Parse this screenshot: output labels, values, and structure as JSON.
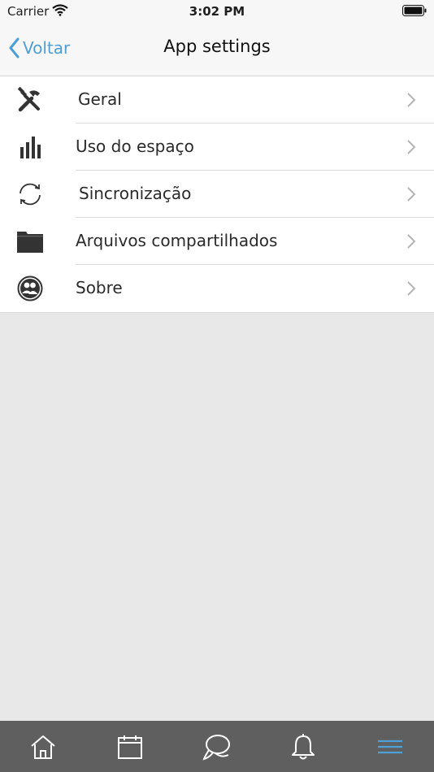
{
  "status_bar": {
    "carrier": "Carrier",
    "time": "3:02 PM"
  },
  "nav": {
    "back_label": "Voltar",
    "title": "App settings"
  },
  "settings": [
    {
      "label": "Geral",
      "icon": "tools-icon"
    },
    {
      "label": "Uso do espaço",
      "icon": "bar-chart-icon"
    },
    {
      "label": "Sincronização",
      "icon": "sync-icon"
    },
    {
      "label": "Arquivos compartilhados",
      "icon": "folder-icon"
    },
    {
      "label": "Sobre",
      "icon": "users-icon"
    }
  ],
  "tabs": [
    {
      "icon": "home-icon"
    },
    {
      "icon": "calendar-icon"
    },
    {
      "icon": "chat-icon"
    },
    {
      "icon": "bell-icon"
    },
    {
      "icon": "menu-icon",
      "active": true
    }
  ],
  "colors": {
    "accent": "#4d9fd6",
    "tab_bar": "#5f5f5f",
    "background": "#e8e8e8"
  }
}
